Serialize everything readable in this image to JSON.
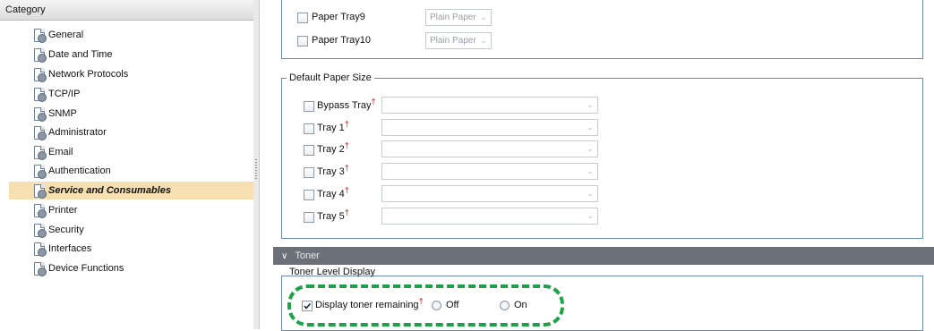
{
  "category_panel": {
    "header": "Category",
    "items": [
      {
        "label": "General",
        "selected": false
      },
      {
        "label": "Date and Time",
        "selected": false
      },
      {
        "label": "Network Protocols",
        "selected": false
      },
      {
        "label": "TCP/IP",
        "selected": false
      },
      {
        "label": "SNMP",
        "selected": false
      },
      {
        "label": "Administrator",
        "selected": false
      },
      {
        "label": "Email",
        "selected": false
      },
      {
        "label": "Authentication",
        "selected": false
      },
      {
        "label": "Service and Consumables",
        "selected": true
      },
      {
        "label": "Printer",
        "selected": false
      },
      {
        "label": "Security",
        "selected": false
      },
      {
        "label": "Interfaces",
        "selected": false
      },
      {
        "label": "Device Functions",
        "selected": false
      }
    ]
  },
  "paper_trays": [
    {
      "label": "Paper Tray9",
      "value": "Plain Paper"
    },
    {
      "label": "Paper Tray10",
      "value": "Plain Paper"
    }
  ],
  "default_paper_size": {
    "legend": "Default Paper Size",
    "rows": [
      {
        "label": "Bypass Tray",
        "sup": "",
        "value": ""
      },
      {
        "label": "Tray 1",
        "sup": "",
        "value": ""
      },
      {
        "label": "Tray 2",
        "sup": "",
        "value": ""
      },
      {
        "label": "Tray 3",
        "sup": "",
        "value": ""
      },
      {
        "label": "Tray 4",
        "sup": "",
        "value": ""
      },
      {
        "label": "Tray 5",
        "sup": "",
        "value": ""
      }
    ],
    "dagger": "†"
  },
  "toner": {
    "section_title": "Toner",
    "legend": "Toner Level Display",
    "display_label": "Display toner remaining",
    "display_checked": true,
    "dagger": "†",
    "off_label": "Off",
    "on_label": "On"
  },
  "colors": {
    "selected_bg": "#f6dfb0",
    "border_blue": "#6a88b5",
    "toner_bar": "#6b7079",
    "highlight_green": "#1fa14a"
  }
}
